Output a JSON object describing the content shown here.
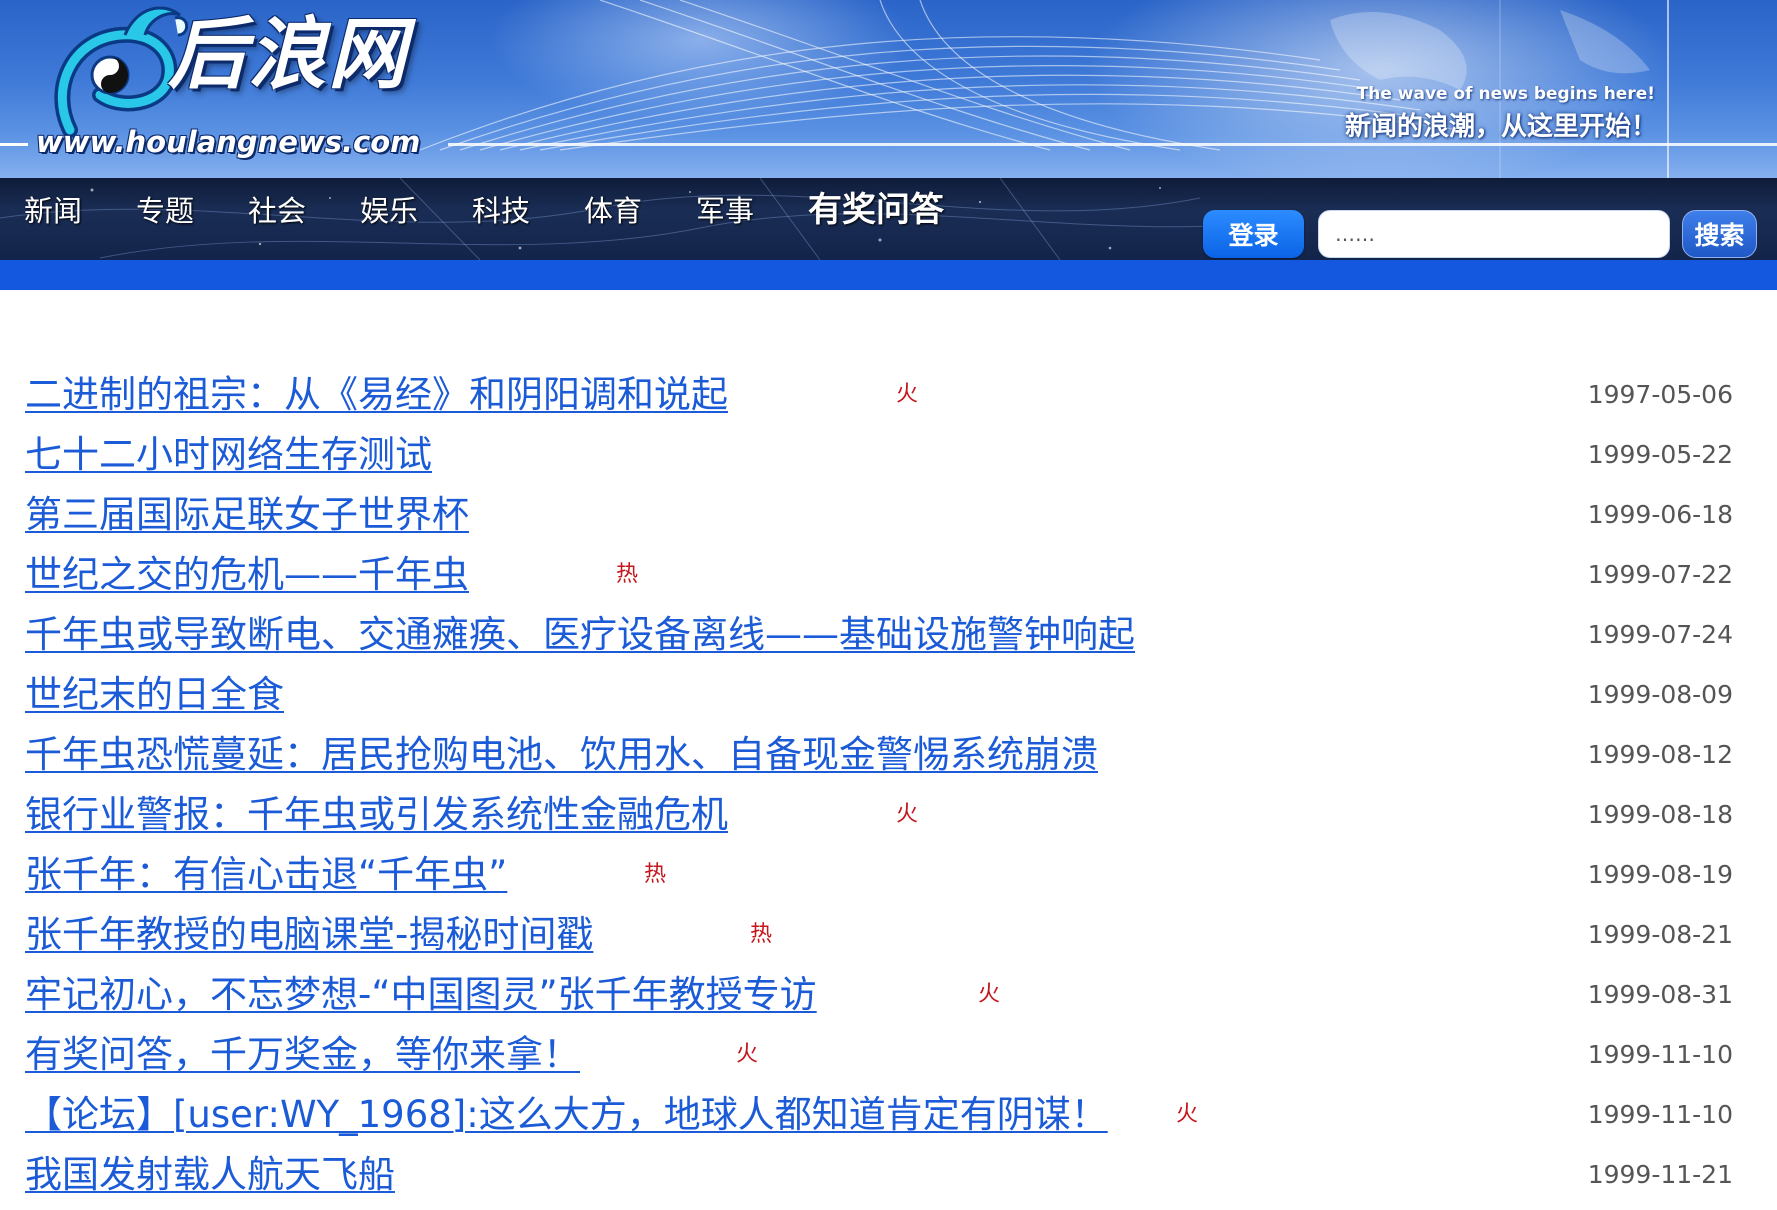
{
  "header": {
    "logo_text": "后浪网",
    "site_url": "www.houlangnews.com",
    "slogan_en": "The wave of news begins here!",
    "slogan_cn": "新闻的浪潮，从这里开始！"
  },
  "nav": {
    "items": [
      {
        "label": "新闻"
      },
      {
        "label": "专题"
      },
      {
        "label": "社会"
      },
      {
        "label": "娱乐"
      },
      {
        "label": "科技"
      },
      {
        "label": "体育"
      },
      {
        "label": "军事"
      },
      {
        "label": "有奖问答"
      }
    ],
    "login_label": "登录",
    "search_placeholder": "……",
    "search_label": "搜索"
  },
  "news": [
    {
      "title": "二进制的祖宗：从《易经》和阴阳调和说起",
      "tag": "火",
      "date": "1997-05-06"
    },
    {
      "title": "七十二小时网络生存测试",
      "tag": "",
      "date": "1999-05-22"
    },
    {
      "title": "第三届国际足联女子世界杯",
      "tag": "",
      "date": "1999-06-18"
    },
    {
      "title": "世纪之交的危机——千年虫",
      "tag": "热",
      "date": "1999-07-22"
    },
    {
      "title": "千年虫或导致断电、交通瘫痪、医疗设备离线——基础设施警钟响起",
      "tag": "",
      "date": "1999-07-24"
    },
    {
      "title": "世纪末的日全食",
      "tag": "",
      "date": "1999-08-09"
    },
    {
      "title": "千年虫恐慌蔓延：居民抢购电池、饮用水、自备现金警惕系统崩溃",
      "tag": "",
      "date": "1999-08-12"
    },
    {
      "title": "银行业警报：千年虫或引发系统性金融危机",
      "tag": "火",
      "date": "1999-08-18"
    },
    {
      "title": "张千年：有信心击退“千年虫”",
      "tag": "热",
      "date": "1999-08-19"
    },
    {
      "title": "张千年教授的电脑课堂-揭秘时间戳",
      "tag": "热",
      "date": "1999-08-21"
    },
    {
      "title": "牢记初心，不忘梦想-“中国图灵”张千年教授专访",
      "tag": "火",
      "date": "1999-08-31"
    },
    {
      "title": "有奖问答，千万奖金，等你来拿！",
      "tag": "火",
      "date": "1999-11-10"
    },
    {
      "title": "【论坛】[user:WY_1968]:这么大方，地球人都知道肯定有阴谋！",
      "tag": "火",
      "date": "1999-11-10"
    },
    {
      "title": "我国发射载人航天飞船",
      "tag": "",
      "date": "1999-11-21"
    }
  ]
}
